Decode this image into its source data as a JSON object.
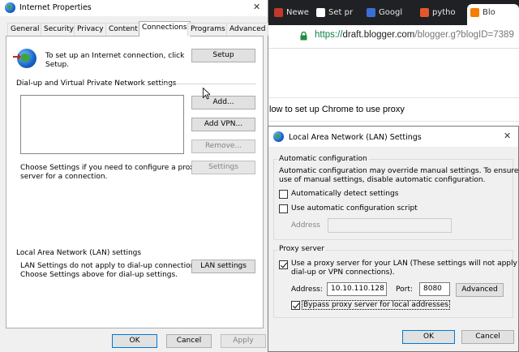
{
  "internet_properties": {
    "title": "Internet Properties",
    "close_glyph": "✕",
    "tabs": [
      "General",
      "Security",
      "Privacy",
      "Content",
      "Connections",
      "Programs",
      "Advanced"
    ],
    "setup_text_line1": "To set up an Internet connection, click",
    "setup_text_line2": "Setup.",
    "setup_button": "Setup",
    "dialup_header": "Dial-up and Virtual Private Network settings",
    "add_button": "Add...",
    "add_vpn_button": "Add VPN...",
    "remove_button": "Remove...",
    "settings_button": "Settings",
    "settings_text_line1": "Choose Settings if you need to configure a proxy",
    "settings_text_line2": "server for a connection.",
    "lan_header": "Local Area Network (LAN) settings",
    "lan_text_line1": "LAN Settings do not apply to dial-up connections.",
    "lan_text_line2": "Choose Settings above for dial-up settings.",
    "lan_settings_button": "LAN settings",
    "ok": "OK",
    "cancel": "Cancel",
    "apply": "Apply"
  },
  "browser": {
    "tabs": [
      {
        "label": "Newe",
        "icon": "newspaper-icon"
      },
      {
        "label": "Set pr",
        "icon": "github-icon"
      },
      {
        "label": "Googl",
        "icon": "document-icon"
      },
      {
        "label": "pytho",
        "icon": "python-icon"
      },
      {
        "label": "Blo",
        "icon": "blogger-icon"
      }
    ],
    "url_scheme": "https://",
    "url_host": "draft.blogger.com",
    "url_rest": "/blogger.g?blogID=7389",
    "page_heading": "low to set up Chrome to use proxy"
  },
  "lan_dialog": {
    "title": "Local Area Network (LAN) Settings",
    "close_glyph": "✕",
    "auto_config_header": "Automatic configuration",
    "auto_config_desc_line1": "Automatic configuration may override manual settings.  To ensure the",
    "auto_config_desc_line2": "use of manual settings, disable automatic configuration.",
    "auto_detect_label": "Automatically detect settings",
    "auto_detect_checked": false,
    "use_script_label": "Use automatic configuration script",
    "use_script_checked": false,
    "address_label": "Address",
    "script_address_value": "",
    "proxy_header": "Proxy server",
    "use_proxy_label_line1": "Use a proxy server for your LAN (These settings will not apply to",
    "use_proxy_label_line2": "dial-up or VPN connections).",
    "use_proxy_checked": true,
    "proxy_address_label": "Address:",
    "proxy_address_value": "10.10.110.128",
    "port_label": "Port:",
    "port_value": "8080",
    "advanced_button": "Advanced",
    "bypass_label": "Bypass proxy server for local addresses",
    "bypass_checked": true,
    "ok": "OK",
    "cancel": "Cancel"
  }
}
